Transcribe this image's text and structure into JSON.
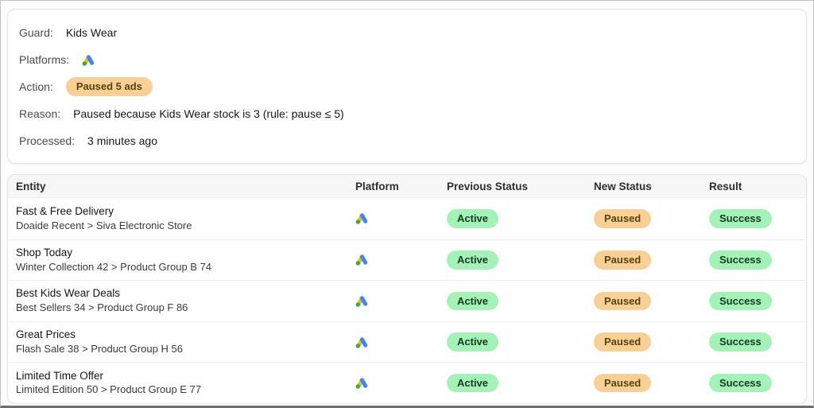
{
  "summary_card": {
    "guard": {
      "label": "Guard:",
      "value": "Kids Wear"
    },
    "platforms": {
      "label": "Platforms:",
      "icon": "google-ads-icon"
    },
    "action": {
      "label": "Action:",
      "badge": "Paused 5 ads"
    },
    "reason": {
      "label": "Reason:",
      "value": "Paused because Kids Wear stock is 3 (rule: pause ≤ 5)"
    },
    "processed": {
      "label": "Processed:",
      "value": "3 minutes ago"
    }
  },
  "results_table": {
    "columns": [
      "Entity",
      "Platform",
      "Previous Status",
      "New Status",
      "Result"
    ],
    "rows": [
      {
        "title": "Fast & Free Delivery",
        "path": "Doaide Recent > Siva Electronic Store",
        "platform_icon": "google-ads-icon",
        "previous_status": "Active",
        "new_status": "Paused",
        "result": "Success"
      },
      {
        "title": "Shop Today",
        "path": "Winter Collection 42 > Product Group B 74",
        "platform_icon": "google-ads-icon",
        "previous_status": "Active",
        "new_status": "Paused",
        "result": "Success"
      },
      {
        "title": "Best Kids Wear Deals",
        "path": "Best Sellers 34 > Product Group F 86",
        "platform_icon": "google-ads-icon",
        "previous_status": "Active",
        "new_status": "Paused",
        "result": "Success"
      },
      {
        "title": "Great Prices",
        "path": "Flash Sale 38 > Product Group H 56",
        "platform_icon": "google-ads-icon",
        "previous_status": "Active",
        "new_status": "Paused",
        "result": "Success"
      },
      {
        "title": "Limited Time Offer",
        "path": "Limited Edition 50 > Product Group E 77",
        "platform_icon": "google-ads-icon",
        "previous_status": "Active",
        "new_status": "Paused",
        "result": "Success"
      }
    ]
  },
  "colors": {
    "badge_orange_bg": "#f8d095",
    "badge_orange_text": "#57430f",
    "badge_green_bg": "#a5f2b8",
    "badge_green_text": "#123a21",
    "google_ads_blue": "#4285F4",
    "google_ads_yellow": "#FBBC04",
    "google_ads_green": "#34A853"
  }
}
